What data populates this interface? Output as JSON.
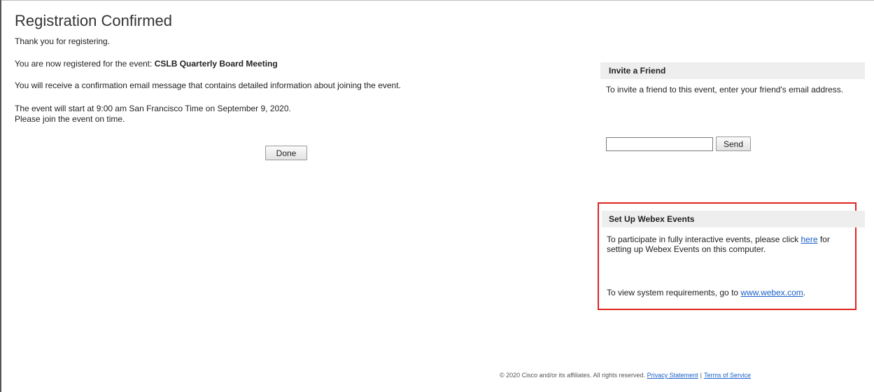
{
  "page": {
    "title": "Registration Confirmed",
    "thanks": "Thank you for registering."
  },
  "registration": {
    "prefix": "You are now registered for the event: ",
    "event_name": "CSLB Quarterly Board Meeting",
    "email_notice": "You will receive a confirmation email message that contains detailed information about joining the event.",
    "start_info": "The event will start at 9:00 am San Francisco Time on September 9, 2020.",
    "join_notice": "Please join the event on time.",
    "done_label": "Done"
  },
  "invite": {
    "header": "Invite a Friend",
    "instructions": "To invite a friend to this event, enter your friend's email address.",
    "email_value": "",
    "send_label": "Send"
  },
  "webex": {
    "header": "Set Up Webex Events",
    "text_prefix": "To participate in fully interactive events, please click ",
    "here_link": "here",
    "text_suffix": " for setting up Webex Events on this computer.",
    "req_prefix": "To view system requirements, go to ",
    "req_link": "www.webex.com",
    "req_suffix": ".",
    "highlight_color": "#e0231f"
  },
  "footer": {
    "copyright": "© 2020 Cisco and/or its affiliates. All rights reserved.",
    "privacy_link": "Privacy Statement",
    "separator": "|",
    "terms_link": "Terms of Service"
  },
  "colors": {
    "link": "#1a5fc8",
    "panel_header_bg": "#eeeeee"
  }
}
